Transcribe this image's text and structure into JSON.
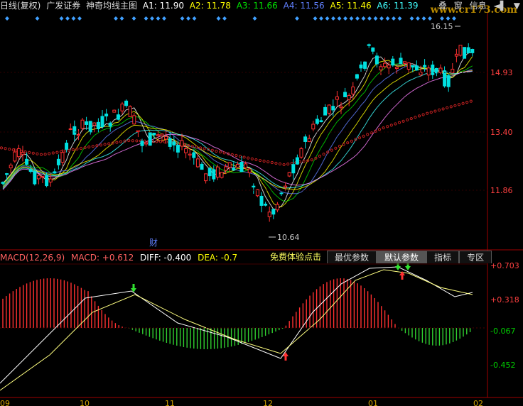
{
  "header": {
    "period": "日线(复权)",
    "stock": "广发证券",
    "indicator": "神奇均线主图",
    "ma": [
      {
        "label": "A1:",
        "value": "11.90",
        "color": "#ffffff"
      },
      {
        "label": "A2:",
        "value": "11.78",
        "color": "#ffff00"
      },
      {
        "label": "A3:",
        "value": "11.66",
        "color": "#00e000"
      },
      {
        "label": "A4:",
        "value": "11.56",
        "color": "#6080ff"
      },
      {
        "label": "A5:",
        "value": "11.46",
        "color": "#ffff00"
      },
      {
        "label": "A6:",
        "value": "11.39",
        "color": "#40ffff"
      }
    ]
  },
  "toolbar": {
    "stack": "叠",
    "window": "窗",
    "info": "信息",
    "arrow": "◄▌",
    "menu": "▼"
  },
  "watermark": "www.cr173.com",
  "price_axis": [
    "14.93",
    "13.40",
    "11.86"
  ],
  "annotations": {
    "high": "16.15",
    "low": "10.64",
    "cai": "财"
  },
  "macd_header": {
    "name": "MACD(12,26,9)",
    "macd": "MACD: +0.612",
    "diff": "DIFF: -0.400",
    "dea": "DEA: -0.7"
  },
  "tabs": {
    "free": "免费体验点击",
    "best": "最优参数",
    "default": "默认参数",
    "indicator": "指标",
    "zone": "专区"
  },
  "macd_axis": [
    "+0.703",
    "+0.318",
    "-0.067",
    "-0.452"
  ],
  "time_axis": [
    "09",
    "10",
    "11",
    "12",
    "01",
    "02"
  ],
  "colors": {
    "up": "#ff3030",
    "down": "#00e0e0",
    "axis": "#a00000",
    "dots": "#c02020"
  }
}
